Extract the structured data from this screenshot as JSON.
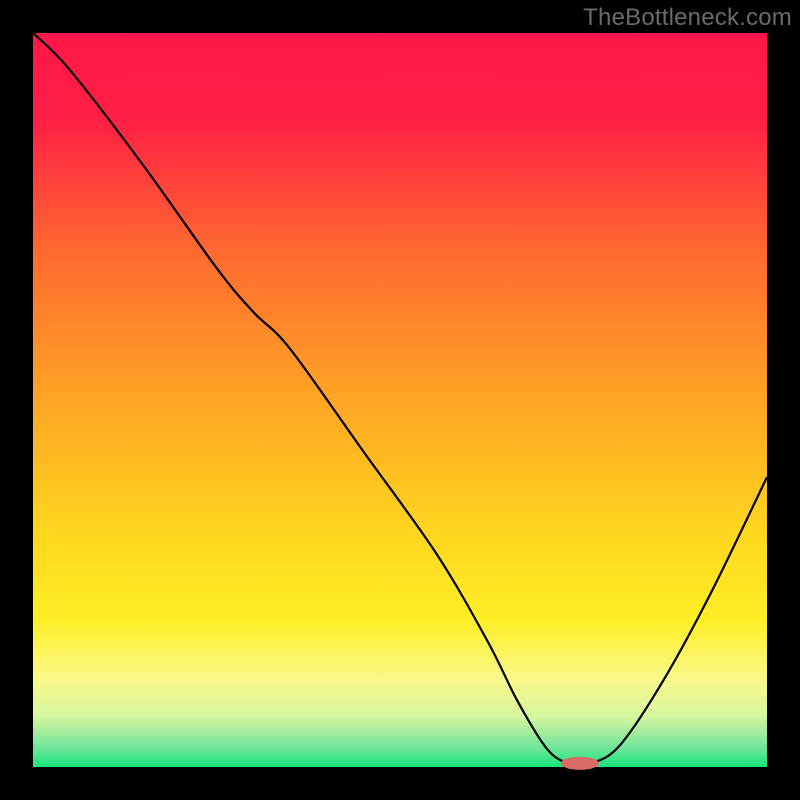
{
  "watermark": "TheBottleneck.com",
  "chart_data": {
    "type": "line",
    "title": "",
    "xlabel": "",
    "ylabel": "",
    "xlim": [
      0,
      100
    ],
    "ylim": [
      0,
      100
    ],
    "grid": false,
    "background_gradient": {
      "stops": [
        {
          "offset": 0.0,
          "color": "#ff1649"
        },
        {
          "offset": 0.12,
          "color": "#ff2044"
        },
        {
          "offset": 0.3,
          "color": "#ff6a30"
        },
        {
          "offset": 0.5,
          "color": "#ffa524"
        },
        {
          "offset": 0.68,
          "color": "#ffd61e"
        },
        {
          "offset": 0.8,
          "color": "#ffee26"
        },
        {
          "offset": 0.88,
          "color": "#f9f98a"
        },
        {
          "offset": 0.93,
          "color": "#d8f6a0"
        },
        {
          "offset": 0.975,
          "color": "#6de59a"
        },
        {
          "offset": 1.0,
          "color": "#17e577"
        }
      ]
    },
    "series": [
      {
        "name": "bottleneck-curve",
        "color": "#000000",
        "stroke_width": 2.2,
        "x": [
          0.0,
          5.0,
          15.0,
          25.0,
          30.0,
          35.0,
          45.0,
          55.0,
          62.0,
          66.0,
          70.0,
          73.0,
          76.0,
          80.0,
          86.0,
          92.5,
          100.0
        ],
        "y": [
          100.0,
          95.0,
          82.0,
          68.0,
          62.0,
          57.0,
          43.0,
          29.0,
          17.0,
          9.0,
          2.5,
          0.5,
          0.5,
          3.0,
          12.0,
          24.0,
          39.5
        ]
      }
    ],
    "marker": {
      "name": "optimal-point",
      "x": 74.5,
      "y": 0.5,
      "rx": 2.6,
      "ry": 0.9,
      "color": "#d86b66"
    }
  }
}
